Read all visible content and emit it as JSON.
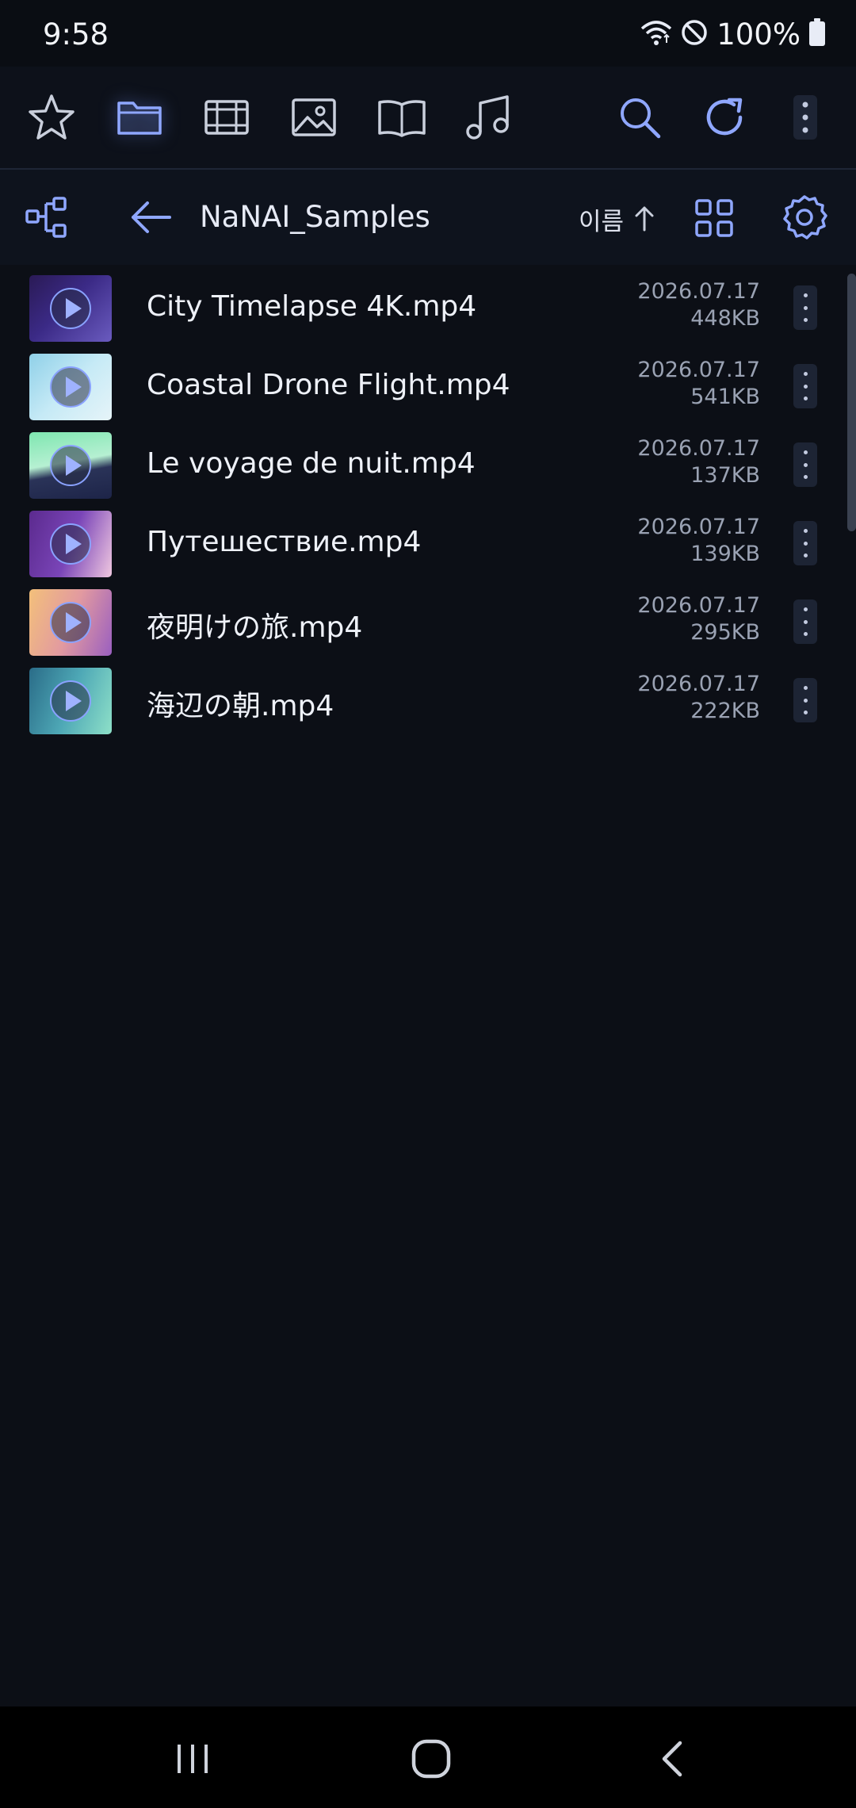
{
  "status_bar": {
    "time": "9:58",
    "battery_percent": "100%",
    "icons": [
      "wifi-icon",
      "do-not-disturb-icon",
      "battery-icon"
    ]
  },
  "toolbar": {
    "left_icons": [
      "star-icon",
      "folder-icon",
      "film-icon",
      "image-icon",
      "book-icon",
      "music-icon"
    ],
    "active_icon": "folder-icon",
    "right_icons": [
      "search-icon",
      "refresh-icon",
      "more-vertical-icon"
    ],
    "accent_color": "#8fa7ff"
  },
  "path_bar": {
    "folder_name": "NaNAI_Samples",
    "sort_label": "이름",
    "sort_direction": "ascending",
    "icons": [
      "tree-icon",
      "back-arrow-icon",
      "sort-up-arrow-icon",
      "grid-view-icon",
      "settings-icon"
    ]
  },
  "files": [
    {
      "name": "City Timelapse 4K.mp4",
      "date": "2026.07.17",
      "size": "448KB"
    },
    {
      "name": "Coastal Drone Flight.mp4",
      "date": "2026.07.17",
      "size": "541KB"
    },
    {
      "name": "Le voyage de nuit.mp4",
      "date": "2026.07.17",
      "size": "137KB"
    },
    {
      "name": "Путешествие.mp4",
      "date": "2026.07.17",
      "size": "139KB"
    },
    {
      "name": "夜明けの旅.mp4",
      "date": "2026.07.17",
      "size": "295KB"
    },
    {
      "name": "海辺の朝.mp4",
      "date": "2026.07.17",
      "size": "222KB"
    }
  ],
  "nav_bar": {
    "icons": [
      "recent-apps-icon",
      "home-icon",
      "back-icon"
    ]
  }
}
